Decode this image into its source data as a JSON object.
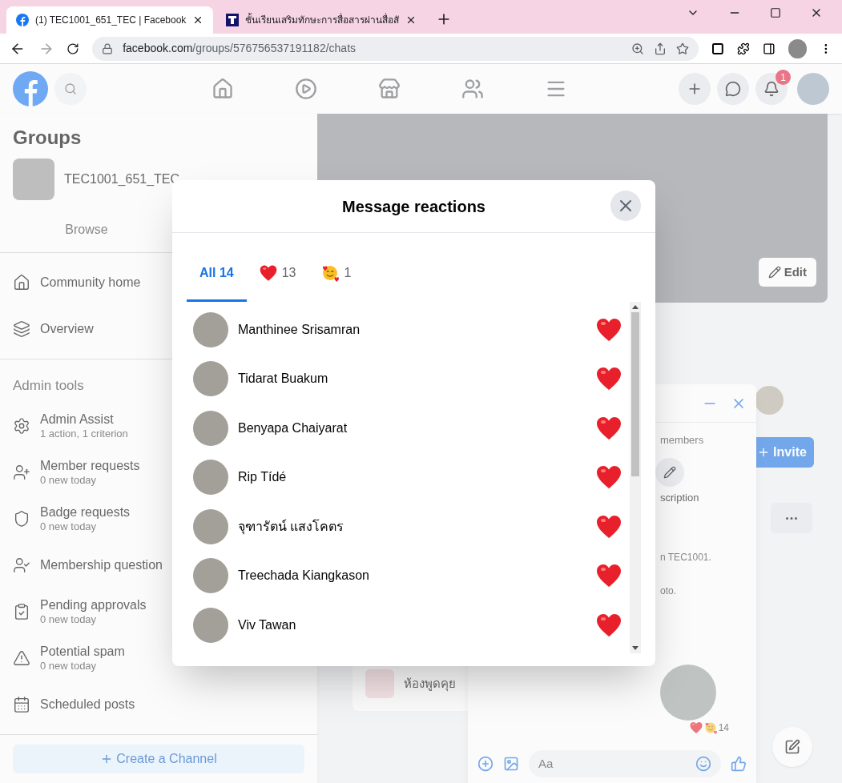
{
  "browser": {
    "tabs": [
      {
        "title": "(1) TEC1001_651_TEC | Facebook",
        "selected": true,
        "kind": "facebook"
      },
      {
        "title": "ชั้นเรียนเสริมทักษะการสื่อสารผ่านสื่อสั",
        "selected": false,
        "kind": "site"
      }
    ],
    "url_host": "facebook.com",
    "url_path": "/groups/576756537191182/chats"
  },
  "header": {
    "notification_count": "1"
  },
  "sidebar": {
    "title": "Groups",
    "group_name": "TEC1001_651_TEC",
    "tabs": [
      {
        "label": "Browse",
        "selected": false
      }
    ],
    "menu": [
      {
        "label": "Community home",
        "kind": "home"
      },
      {
        "label": "Overview",
        "kind": "layers"
      }
    ],
    "section_title": "Admin tools",
    "admin_items": [
      {
        "label": "Admin Assist",
        "subtitle": "1 action, 1 criterion",
        "kind": "gear"
      },
      {
        "label": "Member requests",
        "subtitle": "0 new today",
        "kind": "person"
      },
      {
        "label": "Badge requests",
        "subtitle": "0 new today",
        "kind": "badge"
      },
      {
        "label": "Membership question",
        "kind": "question"
      },
      {
        "label": "Pending approvals",
        "subtitle": "0 new today",
        "kind": "approvals"
      },
      {
        "label": "Potential spam",
        "subtitle": "0 new today",
        "kind": "warning"
      },
      {
        "label": "Scheduled posts",
        "kind": "calendar"
      }
    ],
    "create_button": "Create a Channel"
  },
  "cover": {
    "edit_button": "Edit"
  },
  "main": {
    "invite_button": "Invite",
    "members_text": "members",
    "description_text": "scription",
    "chat_lines": [
      "n TEC1001.",
      "oto."
    ],
    "reaction_count": "14",
    "channel_name": "ห้องพูดคุย",
    "composer_placeholder": "Aa"
  },
  "modal": {
    "title": "Message reactions",
    "tabs": [
      {
        "label": "All 14",
        "kind": "all",
        "selected": true
      },
      {
        "label": "13",
        "kind": "heart",
        "selected": false
      },
      {
        "label": "1",
        "kind": "love",
        "selected": false
      }
    ],
    "people": [
      {
        "name": "Manthinee Srisamran",
        "kind": "heart"
      },
      {
        "name": "Tidarat Buakum",
        "kind": "heart"
      },
      {
        "name": "Benyapa Chaiyarat",
        "kind": "heart"
      },
      {
        "name": "Rip Tídé",
        "kind": "heart"
      },
      {
        "name": "จุฑารัตน์ แสงโคตร",
        "kind": "heart"
      },
      {
        "name": "Treechada Kiangkason",
        "kind": "heart"
      },
      {
        "name": "Viv Tawan",
        "kind": "heart"
      }
    ]
  }
}
